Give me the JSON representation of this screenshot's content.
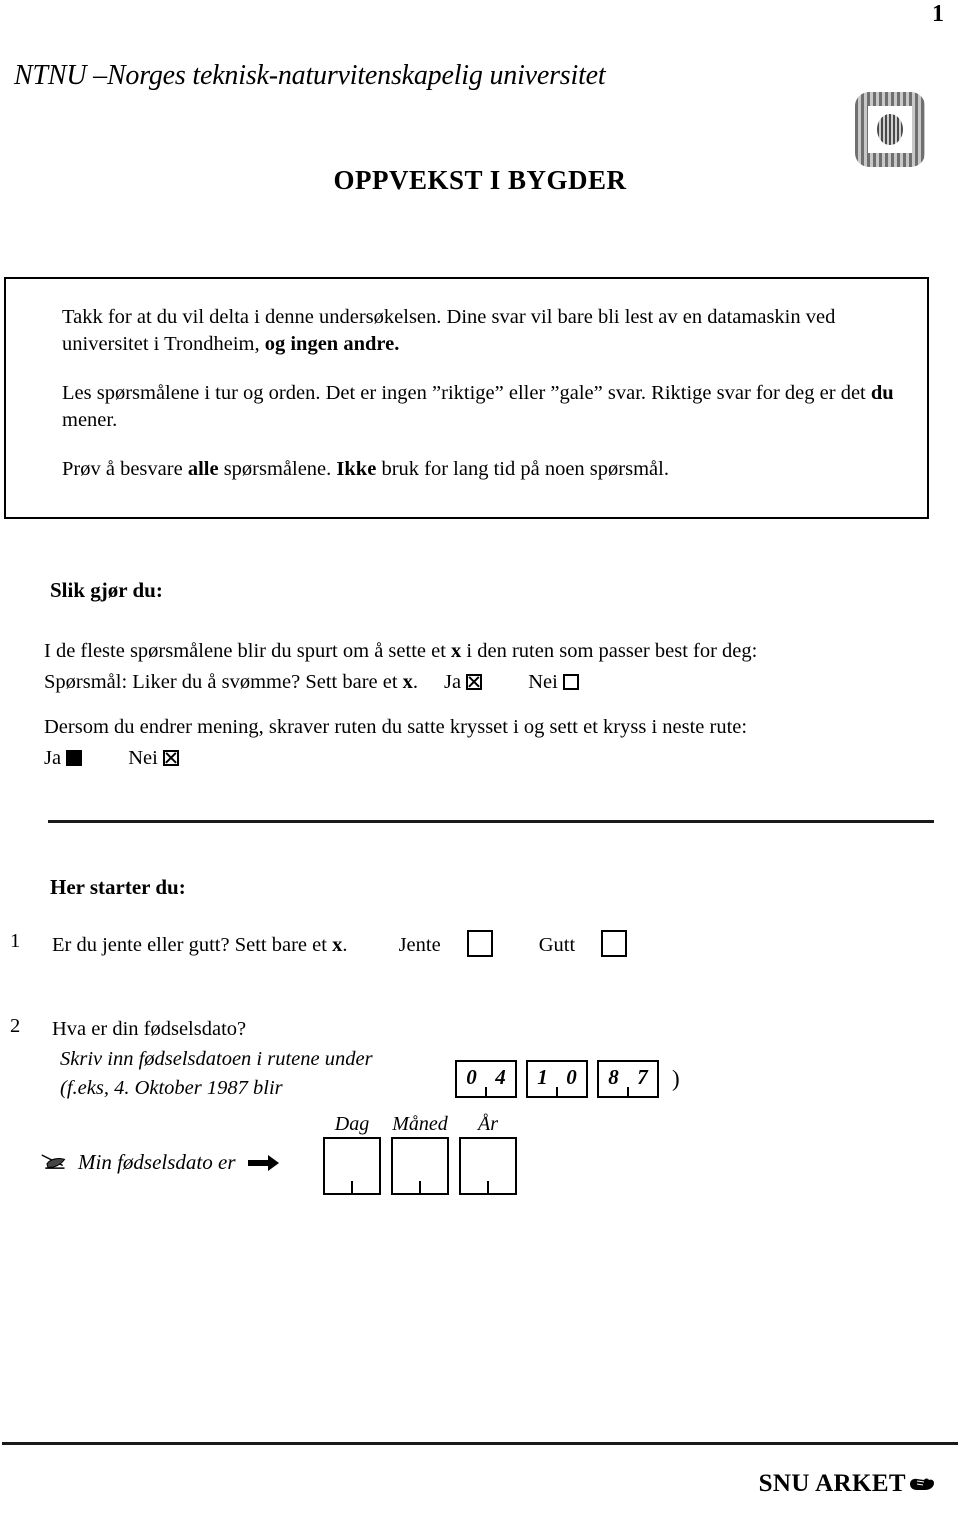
{
  "page": {
    "number": "1",
    "university": "NTNU –Norges teknisk-naturvitenskapelig universitet",
    "title": "OPPVEKST I BYGDER",
    "logo_icon": "ntnu-logo-icon"
  },
  "intro": {
    "paragraph1_a": "Takk for at du vil delta i denne undersøkelsen. Dine svar vil bare bli lest av en datamaskin ved universitet i Trondheim, ",
    "paragraph1_bold": "og ingen andre.",
    "paragraph2_a": "Les spørsmålene i tur og orden. Det er ingen ”riktige” eller ”gale” svar.  Riktige svar for deg er det ",
    "paragraph2_bold": "du",
    "paragraph2_b": " mener.",
    "paragraph3_a": "Prøv å besvare ",
    "paragraph3_bold1": "alle",
    "paragraph3_b": " spørsmålene. ",
    "paragraph3_bold2": "Ikke",
    "paragraph3_c": " bruk for lang tid på noen spørsmål."
  },
  "howto": {
    "heading": "Slik gjør du:",
    "instr_line1_a": "I de fleste spørsmålene blir du spurt om å sette et ",
    "instr_line1_bold": "x",
    "instr_line1_b": " i den ruten som passer best for   deg:",
    "instr_line2_a": "Spørsmål: Liker du å svømme?  Sett bare et ",
    "instr_line2_bold": "x",
    "instr_line2_b": ".",
    "example1_yes_label": "Ja",
    "example1_yes_state": "checked-x",
    "example1_no_label": "Nei",
    "example1_no_state": "empty",
    "change_line1": "Dersom du endrer mening, skraver ruten du satte krysset i og sett et kryss i neste rute:",
    "example2_yes_label": "Ja",
    "example2_yes_state": "filled",
    "example2_no_label": "Nei",
    "example2_no_state": "checked-x"
  },
  "start": {
    "heading": "Her starter du:"
  },
  "questions": [
    {
      "number": "1",
      "text_a": "Er du jente eller gutt? Sett bare et ",
      "text_bold": "x",
      "text_b": ".",
      "option1_label": "Jente",
      "option2_label": "Gutt"
    },
    {
      "number": "2",
      "text_a": "Hva er din fødselsdato?",
      "sub_line1": "Skriv inn fødselsdatoen i rutene under",
      "sub_line2": "(f.eks, 4. Oktober 1987 blir",
      "close_paren": ")"
    }
  ],
  "date_example": {
    "day": [
      "0",
      "4"
    ],
    "month": [
      "1",
      "0"
    ],
    "year": [
      "8",
      "7"
    ]
  },
  "answer_row": {
    "quill_icon": "quill-pen-icon",
    "label": "Min fødselsdato er",
    "arrow_icon": "right-arrow-icon",
    "fields": [
      {
        "caption": "Dag",
        "value": ""
      },
      {
        "caption": "Måned",
        "value": ""
      },
      {
        "caption": "År",
        "value": ""
      }
    ]
  },
  "footer": {
    "text": "SNU ARKET",
    "hand_icon": "pointing-hand-icon"
  },
  "colors": {
    "ink": "#000000",
    "paper": "#ffffff",
    "logo_gray": "#9a9a9a"
  }
}
